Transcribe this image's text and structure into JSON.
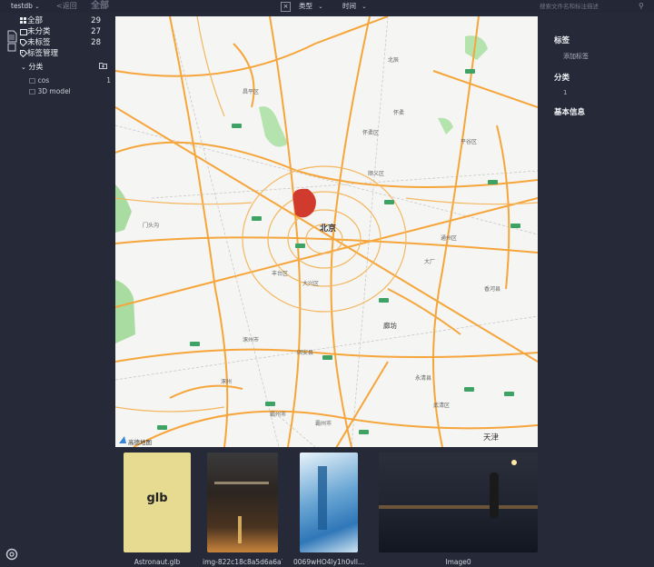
{
  "topbar": {
    "library_name": "testdb",
    "back_label": "<返回",
    "section_title": "全部",
    "filter_type": "类型",
    "filter_time": "时间",
    "search_placeholder": "搜索文件名和标注描述"
  },
  "sidebar": {
    "items": [
      {
        "label": "全部",
        "count": "29",
        "icon": "grid-icon"
      },
      {
        "label": "未分类",
        "count": "27",
        "icon": "document-icon"
      },
      {
        "label": "未标签",
        "count": "28",
        "icon": "tag-icon"
      },
      {
        "label": "标签管理",
        "count": "",
        "icon": "tag-manage-icon"
      }
    ],
    "category_header": "分类",
    "categories": [
      {
        "label": "cos",
        "count": "1"
      },
      {
        "label": "3D model",
        "count": ""
      }
    ]
  },
  "map": {
    "city_main": "北京",
    "city_secondary": "廊坊",
    "city_tianjin": "天津",
    "attribution": "高德地图",
    "marker_color": "#d03b2e"
  },
  "thumbnails": [
    {
      "label": "Astronaut.glb",
      "glyph": "glb"
    },
    {
      "label": "img-822c18c8a5d6a6a7...",
      "glyph": ""
    },
    {
      "label": "0069wHO4ly1h0vll...",
      "glyph": ""
    },
    {
      "label": "Image0",
      "glyph": ""
    }
  ],
  "right_panel": {
    "tags_label": "标签",
    "add_tag_label": "添加标签",
    "category_label": "分类",
    "category_value": "1",
    "basic_info_label": "基本信息"
  }
}
